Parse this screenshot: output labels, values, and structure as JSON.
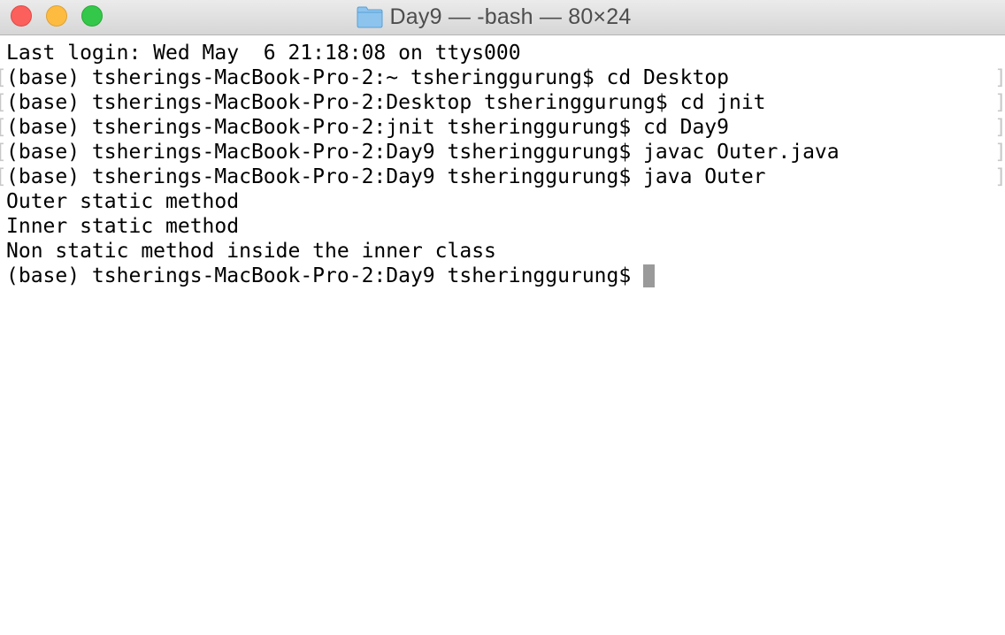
{
  "window": {
    "title": "Day9 — -bash — 80×24",
    "folder_icon": "folder-icon"
  },
  "terminal": {
    "lines": [
      {
        "text": "Last login: Wed May  6 21:18:08 on ttys000",
        "marked": false
      },
      {
        "text": "(base) tsherings-MacBook-Pro-2:~ tsheringgurung$ cd Desktop",
        "marked": true
      },
      {
        "text": "(base) tsherings-MacBook-Pro-2:Desktop tsheringgurung$ cd jnit",
        "marked": true
      },
      {
        "text": "(base) tsherings-MacBook-Pro-2:jnit tsheringgurung$ cd Day9",
        "marked": true
      },
      {
        "text": "(base) tsherings-MacBook-Pro-2:Day9 tsheringgurung$ javac Outer.java",
        "marked": true
      },
      {
        "text": "(base) tsherings-MacBook-Pro-2:Day9 tsheringgurung$ java Outer",
        "marked": true
      },
      {
        "text": "Outer static method",
        "marked": false
      },
      {
        "text": "Inner static method",
        "marked": false
      },
      {
        "text": "Non static method inside the inner class",
        "marked": false
      }
    ],
    "prompt": "(base) tsherings-MacBook-Pro-2:Day9 tsheringgurung$"
  },
  "colors": {
    "close": "#fc605c",
    "minimize": "#fdbc40",
    "zoom": "#34c84a",
    "cursor": "#9a9a9a",
    "folder": "#6ab0e6"
  }
}
